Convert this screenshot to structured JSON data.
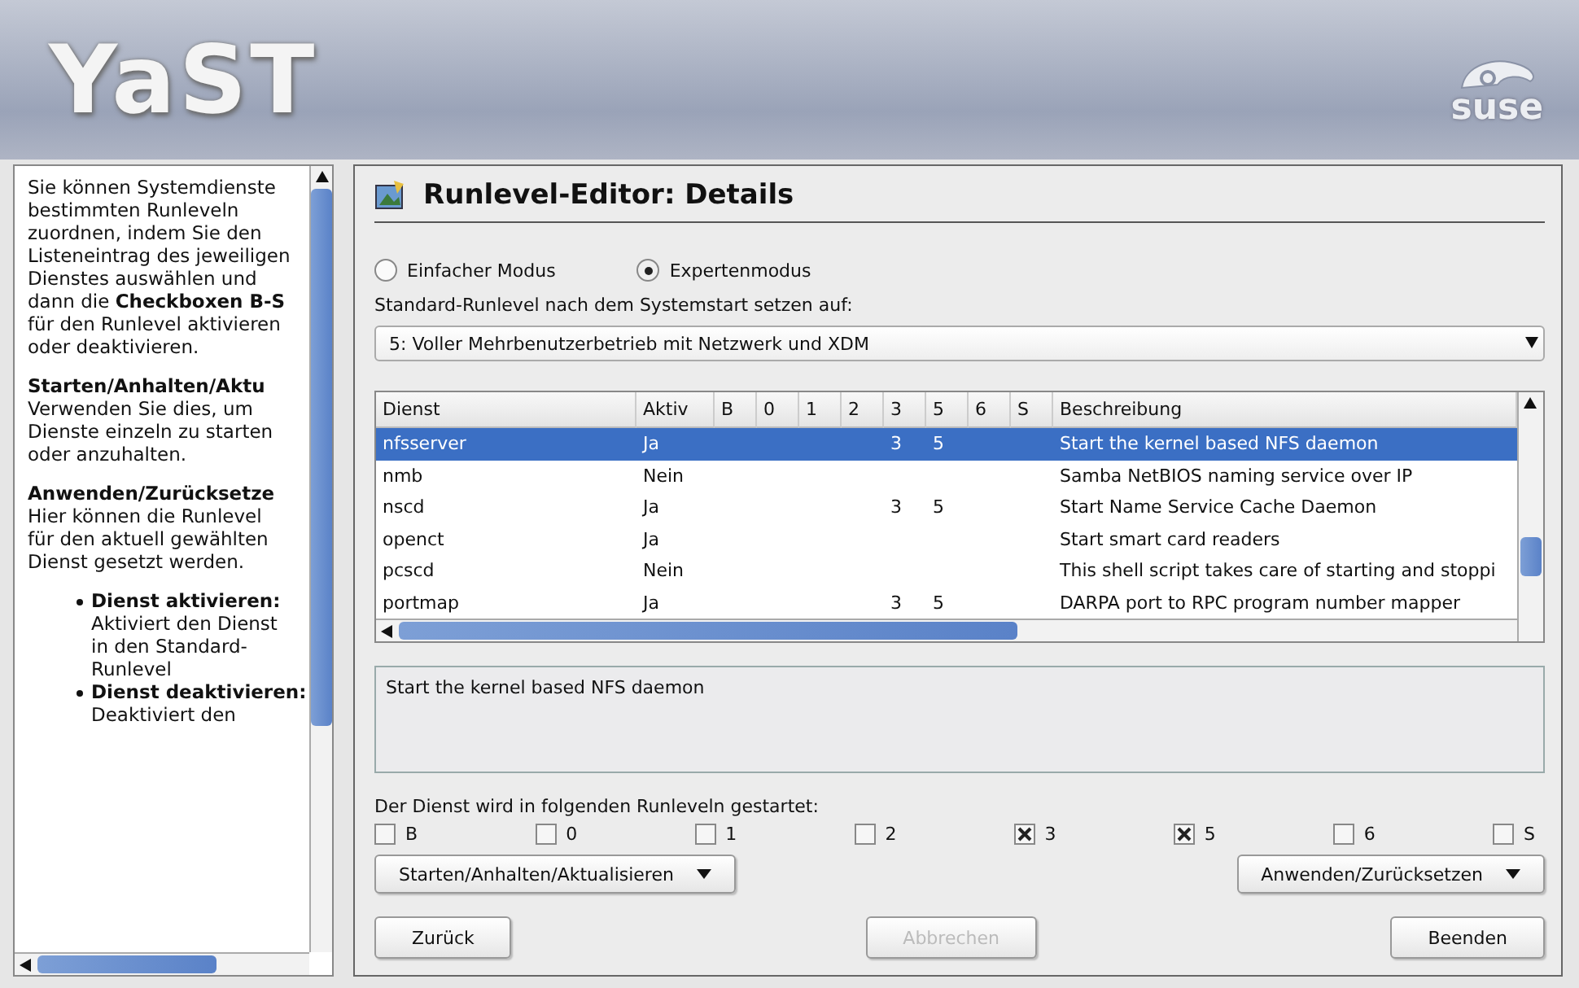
{
  "header": {
    "logo": "YaST",
    "brand": "suse"
  },
  "help": [
    {
      "kind": "paragraph",
      "text": "Sie können Systemdienste bestimmten Runleveln zuordnen, indem Sie den Listeneintrag des jeweiligen Dienstes auswählen und dann die **Checkboxen B-S** für den Runlevel aktivieren oder deaktivieren."
    },
    {
      "kind": "heading",
      "text": "Starten/Anhalten/Aktu"
    },
    {
      "kind": "paragraph",
      "text": "Verwenden Sie dies, um Dienste einzeln zu starten oder anzuhalten."
    },
    {
      "kind": "heading",
      "text": "Anwenden/Zurücksetze"
    },
    {
      "kind": "paragraph",
      "text": "Hier können die Runlevel für den aktuell gewählten Dienst gesetzt werden."
    },
    {
      "kind": "bullet",
      "title": "Dienst aktivieren:",
      "text": "Aktiviert den Dienst in den Standard-Runlevel"
    },
    {
      "kind": "bullet",
      "title": "Dienst deaktivieren:",
      "text": "Deaktiviert den"
    }
  ],
  "title": "Runlevel-Editor: Details",
  "modes": [
    {
      "label": "Einfacher Modus",
      "selected": false
    },
    {
      "label": "Expertenmodus",
      "selected": true
    }
  ],
  "default_runlevel": {
    "label": "Standard-Runlevel nach dem Systemstart setzen auf:",
    "value": "5: Voller Mehrbenutzerbetrieb mit Netzwerk und XDM"
  },
  "table": {
    "columns": [
      "Dienst",
      "Aktiv",
      "B",
      "0",
      "1",
      "2",
      "3",
      "5",
      "6",
      "S",
      "Beschreibung"
    ],
    "rows": [
      {
        "selected": true,
        "cells": [
          "nfsserver",
          "Ja",
          "",
          "",
          "",
          "",
          "3",
          "5",
          "",
          "",
          "Start the kernel based NFS daemon"
        ]
      },
      {
        "selected": false,
        "cells": [
          "nmb",
          "Nein",
          "",
          "",
          "",
          "",
          "",
          "",
          "",
          "",
          "Samba NetBIOS naming service over IP"
        ]
      },
      {
        "selected": false,
        "cells": [
          "nscd",
          "Ja",
          "",
          "",
          "",
          "",
          "3",
          "5",
          "",
          "",
          "Start Name Service Cache Daemon"
        ]
      },
      {
        "selected": false,
        "cells": [
          "openct",
          "Ja",
          "",
          "",
          "",
          "",
          "",
          "",
          "",
          "",
          "Start smart card readers"
        ]
      },
      {
        "selected": false,
        "cells": [
          "pcscd",
          "Nein",
          "",
          "",
          "",
          "",
          "",
          "",
          "",
          "",
          "This shell script takes care of starting and stoppi"
        ]
      },
      {
        "selected": false,
        "cells": [
          "portmap",
          "Ja",
          "",
          "",
          "",
          "",
          "3",
          "5",
          "",
          "",
          "DARPA port to RPC program number mapper"
        ]
      }
    ]
  },
  "description": "Start the kernel based NFS daemon",
  "runlevels_label": "Der Dienst wird in folgenden Runleveln gestartet:",
  "runlevels": [
    {
      "label": "B",
      "checked": false
    },
    {
      "label": "0",
      "checked": false
    },
    {
      "label": "1",
      "checked": false
    },
    {
      "label": "2",
      "checked": false
    },
    {
      "label": "3",
      "checked": true
    },
    {
      "label": "5",
      "checked": true
    },
    {
      "label": "6",
      "checked": false
    },
    {
      "label": "S",
      "checked": false
    }
  ],
  "action_menus": [
    "Starten/Anhalten/Aktualisieren",
    "Anwenden/Zurücksetzen"
  ],
  "buttons": [
    {
      "label": "Zurück",
      "disabled": false
    },
    {
      "label": "Abbrechen",
      "disabled": true
    },
    {
      "label": "Beenden",
      "disabled": false
    }
  ]
}
